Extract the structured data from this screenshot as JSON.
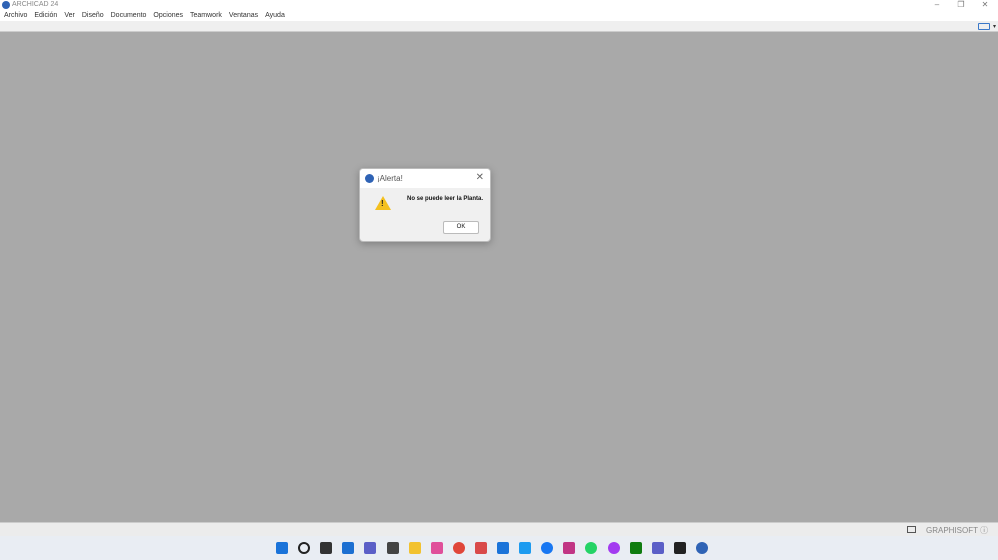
{
  "window": {
    "title": "ARCHICAD 24",
    "minimize": "–",
    "maximize": "❐",
    "close": "✕"
  },
  "menu": [
    "Archivo",
    "Edición",
    "Ver",
    "Diseño",
    "Documento",
    "Opciones",
    "Teamwork",
    "Ventanas",
    "Ayuda"
  ],
  "dialog": {
    "title": "¡Alerta!",
    "close": "✕",
    "message": "No se puede leer la Planta.",
    "warning_glyph": "!",
    "ok_label": "OK"
  },
  "toolbar": {
    "caret": "▾"
  },
  "status": {
    "brand": "GRAPHISOFT ⓘ"
  },
  "taskbar": [
    {
      "name": "start",
      "color": "#1a73d9"
    },
    {
      "name": "search",
      "color": "#222"
    },
    {
      "name": "task-view",
      "color": "#333"
    },
    {
      "name": "widgets",
      "color": "#1c6fd1"
    },
    {
      "name": "chat",
      "color": "#5b5fc7"
    },
    {
      "name": "app-line",
      "color": "#444"
    },
    {
      "name": "file-explorer",
      "color": "#f2c230"
    },
    {
      "name": "itunes",
      "color": "#e04f9a"
    },
    {
      "name": "chrome",
      "color": "#e0463a"
    },
    {
      "name": "snipping-tool",
      "color": "#d94a4a"
    },
    {
      "name": "mail",
      "color": "#1a73d9"
    },
    {
      "name": "twitter",
      "color": "#1d9bf0"
    },
    {
      "name": "facebook",
      "color": "#1877f2"
    },
    {
      "name": "instagram",
      "color": "#c13584"
    },
    {
      "name": "whatsapp",
      "color": "#25d366"
    },
    {
      "name": "messenger",
      "color": "#a33bf0"
    },
    {
      "name": "xbox",
      "color": "#107c10"
    },
    {
      "name": "teams",
      "color": "#5b5fc7"
    },
    {
      "name": "app-line-2",
      "color": "#222"
    },
    {
      "name": "archicad",
      "color": "#2f63b5"
    }
  ]
}
